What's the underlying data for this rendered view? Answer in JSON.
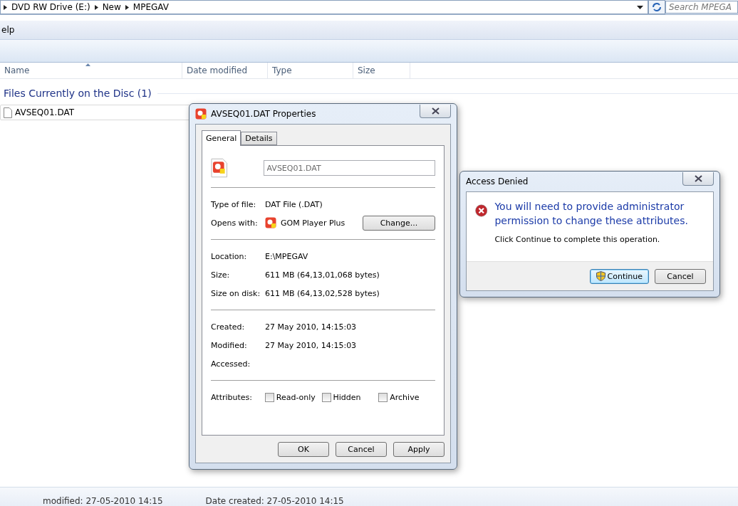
{
  "explorer": {
    "breadcrumb": [
      "DVD RW Drive (E:)",
      "New",
      "MPEGAV"
    ],
    "search": {
      "placeholder": "Search MPEGA"
    },
    "menu": [
      "elp"
    ],
    "columns": [
      "Name",
      "Date modified",
      "Type",
      "Size"
    ],
    "group": "Files Currently on the Disc (1)",
    "files": [
      {
        "name": "AVSEQ01.DAT"
      }
    ],
    "details": [
      "modified: 27-05-2010 14:15",
      "Date created: 27-05-2010 14:15"
    ]
  },
  "properties": {
    "title": "AVSEQ01.DAT Properties",
    "tabs": [
      {
        "label": "General",
        "selected": true
      },
      {
        "label": "Details",
        "selected": false
      }
    ],
    "filename": "AVSEQ01.DAT",
    "sections": [
      [
        {
          "label": "Type of file:",
          "value": "DAT File (.DAT)",
          "kind": "text"
        },
        {
          "label": "Opens with:",
          "value": "GOM Player Plus",
          "kind": "app",
          "button": "Change..."
        }
      ],
      [
        {
          "label": "Location:",
          "value": "E:\\MPEGAV",
          "kind": "text"
        },
        {
          "label": "Size:",
          "value": "611 MB (64,13,01,068 bytes)",
          "kind": "text"
        },
        {
          "label": "Size on disk:",
          "value": "611 MB (64,13,02,528 bytes)",
          "kind": "text"
        }
      ],
      [
        {
          "label": "Created:",
          "value": "27 May 2010, 14:15:03",
          "kind": "text"
        },
        {
          "label": "Modified:",
          "value": "27 May 2010, 14:15:03",
          "kind": "text"
        },
        {
          "label": "Accessed:",
          "kind": "text"
        }
      ]
    ],
    "attributes_label": "Attributes:",
    "attributes": [
      {
        "label": "Read-only",
        "checked": false
      },
      {
        "label": "Hidden",
        "checked": false
      },
      {
        "label": "Archive",
        "checked": false
      }
    ],
    "buttons": [
      "OK",
      "Cancel",
      "Apply"
    ]
  },
  "access_denied": {
    "title": "Access Denied",
    "heading": "You will need to provide administrator permission to change these attributes.",
    "message": "Click Continue to complete this operation.",
    "buttons": [
      {
        "label": "Continue",
        "kind": "shield",
        "focused": true
      },
      {
        "label": "Cancel",
        "kind": "plain",
        "focused": false
      }
    ]
  }
}
